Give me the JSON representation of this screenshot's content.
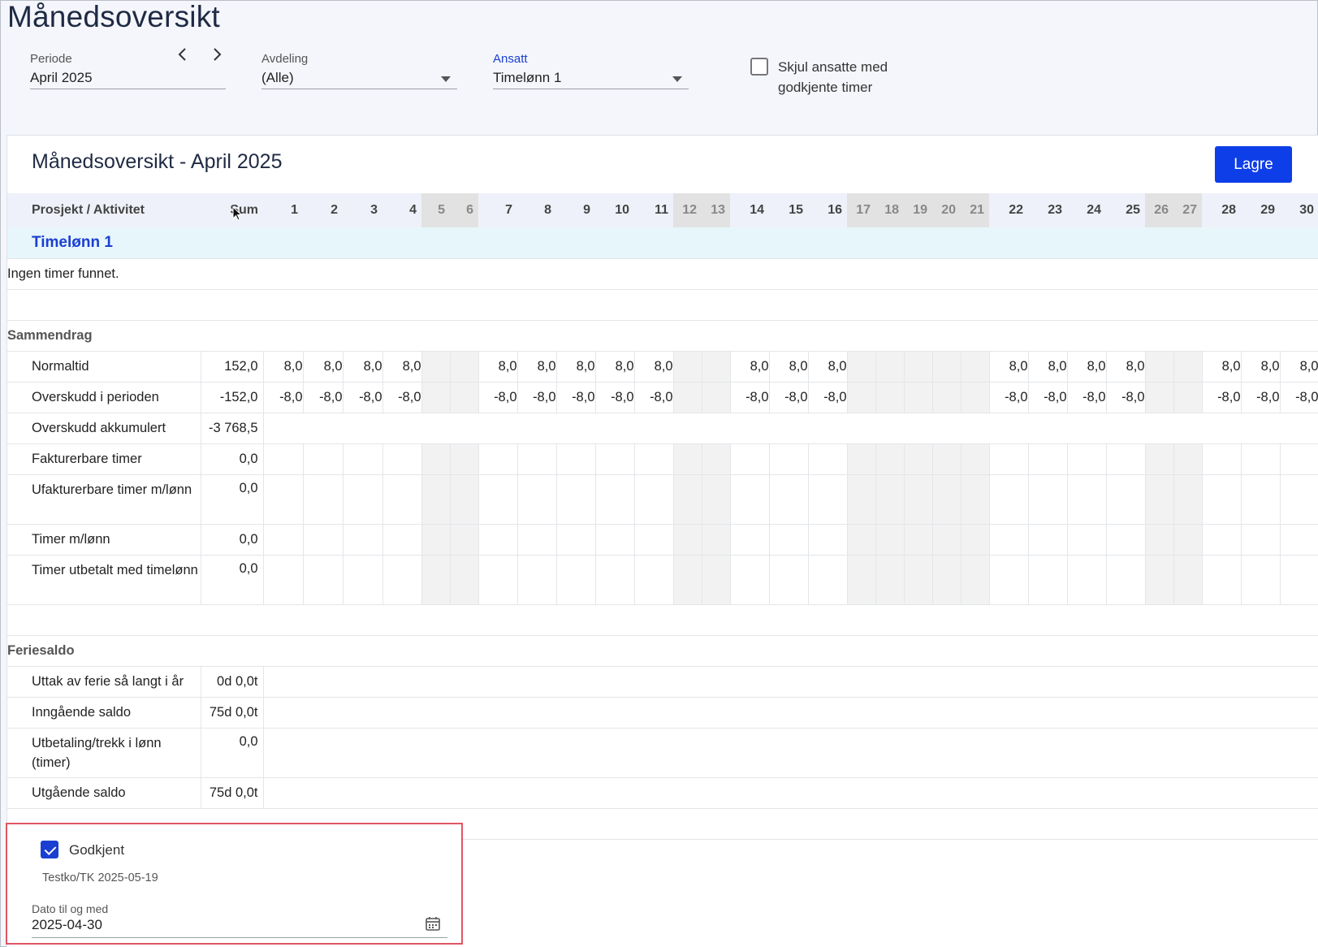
{
  "page": {
    "title": "Månedsoversikt"
  },
  "filters": {
    "periode": {
      "label": "Periode",
      "value": "April 2025"
    },
    "avdeling": {
      "label": "Avdeling",
      "value": "(Alle)"
    },
    "ansatt": {
      "label": "Ansatt",
      "value": "Timelønn 1"
    },
    "hide_approved": {
      "label": "Skjul ansatte med godkjente timer",
      "checked": false
    }
  },
  "card": {
    "title": "Månedsoversikt - April 2025",
    "save_label": "Lagre"
  },
  "table": {
    "first_header": "Prosjekt / Aktivitet",
    "sum_header": "Sum",
    "days": [
      "1",
      "2",
      "3",
      "4",
      "5",
      "6",
      "7",
      "8",
      "9",
      "10",
      "11",
      "12",
      "13",
      "14",
      "15",
      "16",
      "17",
      "18",
      "19",
      "20",
      "21",
      "22",
      "23",
      "24",
      "25",
      "26",
      "27",
      "28",
      "29",
      "30"
    ],
    "weekend_days": [
      "5",
      "6",
      "12",
      "13",
      "17",
      "18",
      "19",
      "20",
      "21",
      "26",
      "27"
    ],
    "employee": "Timelønn 1",
    "no_hours": "Ingen timer funnet.",
    "summary_title": "Sammendrag",
    "summary_rows": [
      {
        "label": "Normaltid",
        "sum": "152,0",
        "daily": "8,0",
        "mode": "daily"
      },
      {
        "label": "Overskudd i perioden",
        "sum": "-152,0",
        "daily": "-8,0",
        "mode": "daily"
      },
      {
        "label": "Overskudd akkumulert",
        "sum": "-3 768,5",
        "mode": "single"
      },
      {
        "label": "Fakturerbare timer",
        "sum": "0,0",
        "mode": "grid"
      },
      {
        "label": "Ufakturerbare timer m/lønn",
        "sum": "0,0",
        "mode": "grid",
        "tall": true
      },
      {
        "label": "Timer m/lønn",
        "sum": "0,0",
        "mode": "grid"
      },
      {
        "label": "Timer utbetalt med timelønn",
        "sum": "0,0",
        "mode": "grid",
        "tall": true
      }
    ],
    "vacation_title": "Feriesaldo",
    "vacation_rows": [
      {
        "label": "Uttak av ferie så langt i år",
        "sum": "0d 0,0t"
      },
      {
        "label": "Inngående saldo",
        "sum": "75d 0,0t"
      },
      {
        "label": "Utbetaling/trekk i lønn (timer)",
        "sum": "0,0",
        "tall": true
      },
      {
        "label": "Utgående saldo",
        "sum": "75d 0,0t"
      }
    ]
  },
  "approval": {
    "label": "Godkjent",
    "checked": true,
    "meta": "Testko/TK 2025-05-19",
    "date_label": "Dato til og med",
    "date_value": "2025-04-30"
  },
  "icons": {
    "prev": "chevron-left-icon",
    "next": "chevron-right-icon",
    "calendar": "calendar-icon",
    "cursor": "mouse-cursor-icon"
  },
  "colors": {
    "accent": "#0d3ee8",
    "highlight_border": "#e05563",
    "employee_row_bg": "#e7f6fb",
    "weekend_bg": "#e2e2e2"
  }
}
